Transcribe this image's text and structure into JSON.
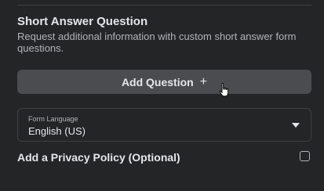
{
  "short_answer": {
    "title": "Short Answer Question",
    "description": "Request additional information with custom short answer form questions."
  },
  "add_question": {
    "label": "Add Question",
    "icon": "plus-icon",
    "icon_glyph": "+"
  },
  "form_language": {
    "label": "Form Language",
    "value": "English (US)",
    "icon": "caret-down-icon"
  },
  "privacy_policy": {
    "label": "Add a Privacy Policy (Optional)",
    "checked": false
  },
  "colors": {
    "background": "#242526",
    "button": "#4b4c4f",
    "text_primary": "#e4e6eb",
    "text_secondary": "#b0b3b8",
    "border": "#3e4042"
  }
}
